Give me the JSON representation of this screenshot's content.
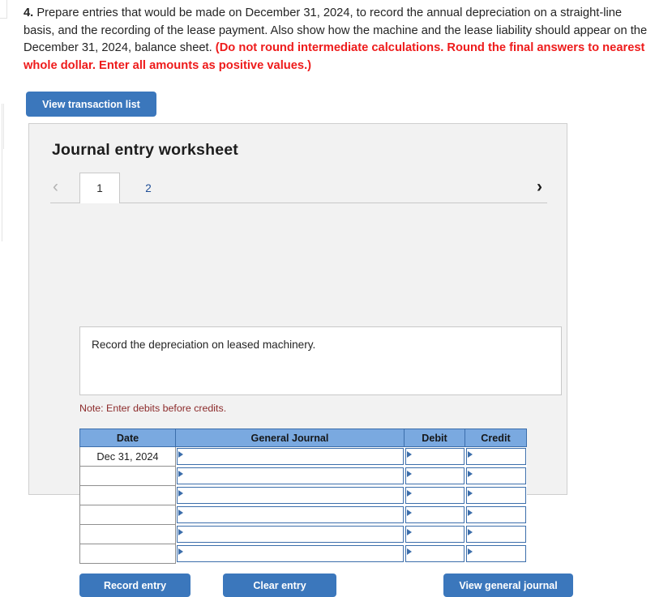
{
  "prompt": {
    "number": "4.",
    "body": " Prepare entries that would be made on December 31, 2024, to record the annual depreciation on a straight-line basis, and the recording of the lease payment. Also show how the machine and the lease liability should appear on the December 31, 2024, balance sheet. ",
    "emphasis": "(Do not round intermediate calculations. Round the final answers to nearest whole dollar. Enter all amounts as positive values.)"
  },
  "toolbar": {
    "view_transaction_list_label": "View transaction list"
  },
  "worksheet": {
    "title": "Journal entry worksheet",
    "tabs": [
      {
        "label": "1",
        "active": true
      },
      {
        "label": "2",
        "active": false
      }
    ],
    "prev_arrow": "‹",
    "next_arrow": "›",
    "description": "Record the depreciation on leased machinery.",
    "note": "Note: Enter debits before credits.",
    "table": {
      "columns": [
        "Date",
        "General Journal",
        "Debit",
        "Credit"
      ],
      "rows": [
        {
          "date": "Dec 31, 2024",
          "general_journal": "",
          "debit": "",
          "credit": ""
        },
        {
          "date": "",
          "general_journal": "",
          "debit": "",
          "credit": ""
        },
        {
          "date": "",
          "general_journal": "",
          "debit": "",
          "credit": ""
        },
        {
          "date": "",
          "general_journal": "",
          "debit": "",
          "credit": ""
        },
        {
          "date": "",
          "general_journal": "",
          "debit": "",
          "credit": ""
        },
        {
          "date": "",
          "general_journal": "",
          "debit": "",
          "credit": ""
        }
      ]
    },
    "actions": {
      "record_entry_label": "Record entry",
      "clear_entry_label": "Clear entry",
      "view_general_journal_label": "View general journal"
    }
  },
  "colors": {
    "button_blue": "#3b77bc",
    "header_blue": "#7aa9e0",
    "emphasis_red": "#ee1b1b",
    "note_maroon": "#8c2b2b",
    "panel_gray": "#f2f2f2"
  }
}
